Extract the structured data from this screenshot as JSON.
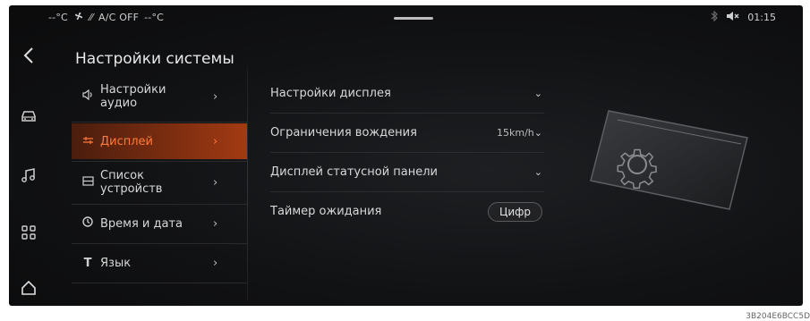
{
  "statusbar": {
    "left_temp": "--°C",
    "fan_icon": "fan-icon",
    "ac_label": "A/C OFF",
    "right_temp": "--°C",
    "bluetooth_icon": "bluetooth-icon",
    "volume_icon": "volume-mute-icon",
    "time": "01:15"
  },
  "rail": {
    "items": [
      "back-icon",
      "car-icon",
      "music-icon",
      "apps-grid-icon",
      "home-icon"
    ]
  },
  "title": "Настройки системы",
  "menu": {
    "items": [
      {
        "label_line1": "Настройки",
        "label_line2": "аудио",
        "icon": "speaker-icon",
        "chevron": "›"
      },
      {
        "label_line1": "Дисплей",
        "label_line2": "",
        "icon": "display-adjust-icon",
        "chevron": "›",
        "active": true
      },
      {
        "label_line1": "Список",
        "label_line2": "устройств",
        "icon": "device-list-icon",
        "chevron": "›"
      },
      {
        "label_line1": "Время и дата",
        "label_line2": "",
        "icon": "clock-icon",
        "chevron": "›"
      },
      {
        "label_line1": "Язык",
        "label_line2": "",
        "icon": "language-icon",
        "chevron": "›"
      }
    ]
  },
  "settings": {
    "rows": [
      {
        "label": "Настройки дисплея",
        "value": "",
        "chevron": "⌄"
      },
      {
        "label": "Ограничения вождения",
        "value": "15km/h",
        "chevron": "⌄"
      },
      {
        "label": "Дисплей статусной панели",
        "value": "",
        "chevron": "⌄"
      },
      {
        "label": "Таймер ожидания",
        "button": "Цифр"
      }
    ]
  },
  "colors": {
    "accent": "#ff7a3a",
    "active_bg": "#a23a12",
    "screen_bg": "#111214"
  },
  "footer_code": "3B204E6BCC5D"
}
